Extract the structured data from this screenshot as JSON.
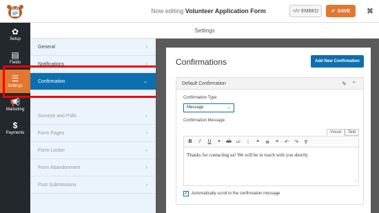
{
  "header": {
    "editing_prefix": "Now editing",
    "form_name": "Volunteer Application Form",
    "embed_label": "EMBED",
    "save_label": "SAVE",
    "close_glyph": "✖"
  },
  "rail": {
    "items": [
      {
        "label": "Setup",
        "icon": "gear-icon"
      },
      {
        "label": "Fields",
        "icon": "fields-icon"
      },
      {
        "label": "Settings",
        "icon": "sliders-icon"
      },
      {
        "label": "Marketing",
        "icon": "megaphone-icon"
      },
      {
        "label": "Payments",
        "icon": "dollar-icon"
      }
    ]
  },
  "settings_header": "Settings",
  "sections": [
    {
      "label": "General"
    },
    {
      "label": "Notifications"
    },
    {
      "label": "Confirmation"
    },
    {
      "label": "Surveys and Polls"
    },
    {
      "label": "Form Pages"
    },
    {
      "label": "Form Locker"
    },
    {
      "label": "Form Abandonment"
    },
    {
      "label": "Post Submissions"
    }
  ],
  "panel": {
    "title": "Confirmations",
    "add_button": "Add New Confirmation",
    "default_label": "Default Confirmation",
    "type_label": "Confirmation Type",
    "type_value": "Message",
    "message_label": "Confirmation Message",
    "tab_visual": "Visual",
    "tab_text": "Text",
    "message_text": "Thanks for contacting us! We will be in touch with you shortly.",
    "scroll_label": "Automatically scroll to the confirmation message"
  },
  "colors": {
    "accent": "#e27730",
    "primary": "#0e6fb0",
    "rail_bg": "#23282d",
    "highlight": "#e00000"
  }
}
